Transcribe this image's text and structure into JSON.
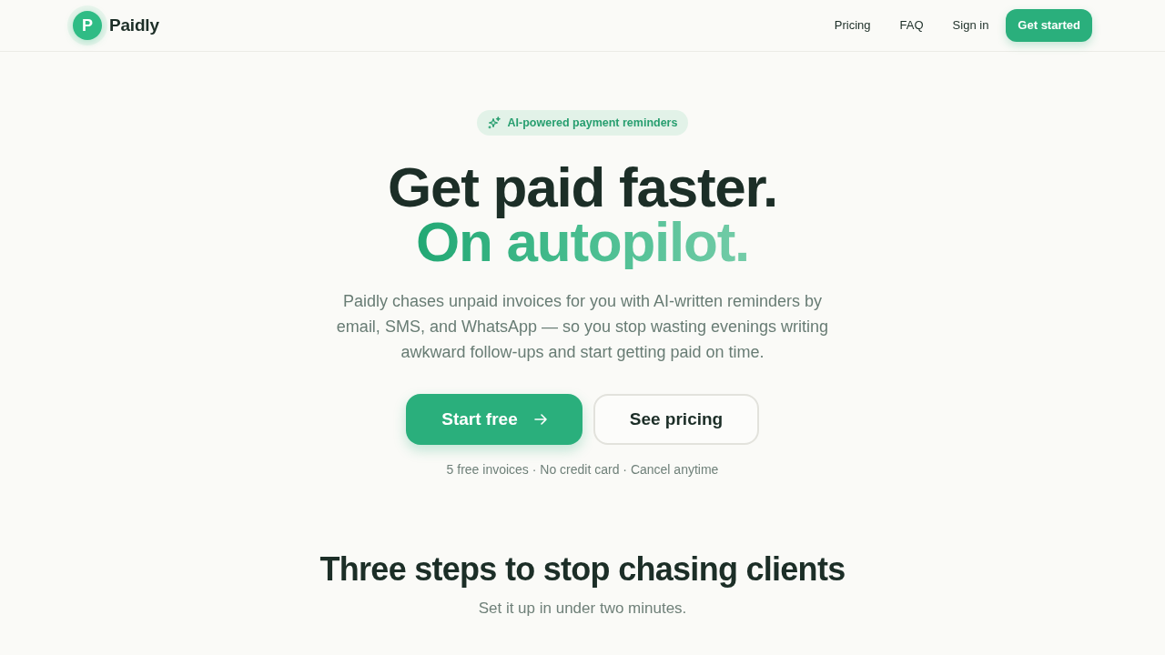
{
  "nav": {
    "brand": {
      "initial": "P",
      "name": "Paidly"
    },
    "links": [
      "Pricing",
      "FAQ",
      "Sign in"
    ],
    "cta": "Get started"
  },
  "hero": {
    "badge": "AI-powered payment reminders",
    "headline": "Get paid faster.",
    "headline_accent": "On autopilot.",
    "description": "Paidly chases unpaid invoices for you with AI-written reminders by email, SMS, and WhatsApp — so you stop wasting evenings writing awkward follow-ups and start getting paid on time.",
    "buttons": [
      {
        "label": "Start free",
        "kind": "primary"
      },
      {
        "label": "See pricing",
        "kind": "secondary"
      }
    ],
    "note": "5 free invoices · No credit card · Cancel anytime"
  },
  "steps_section": {
    "title": "Three steps to stop chasing clients",
    "subtitle": "Set it up in under two minutes."
  }
}
